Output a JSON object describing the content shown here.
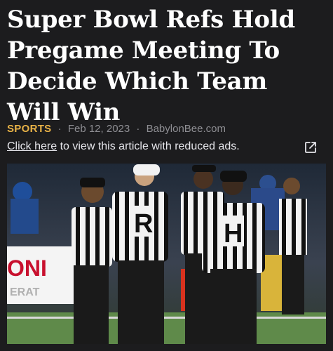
{
  "article": {
    "headline": "Super Bowl Refs Hold Pregame Meeting To Decide Which Team Will Win",
    "category": "SPORTS",
    "date": "Feb 12, 2023",
    "source": "BabylonBee.com",
    "separator": "·"
  },
  "reduced_ads": {
    "link_text": "Click here",
    "rest_text": " to view this article with reduced ads.",
    "icon": "external-link-icon"
  },
  "photo": {
    "description_icon": "photo",
    "jersey_letters": [
      "R",
      "H"
    ],
    "banner_text": [
      "ONI",
      "ERAT"
    ]
  },
  "colors": {
    "background": "#1c1c1e",
    "category": "#e8b247",
    "headline": "#ffffff",
    "meta": "#8e8e93"
  }
}
